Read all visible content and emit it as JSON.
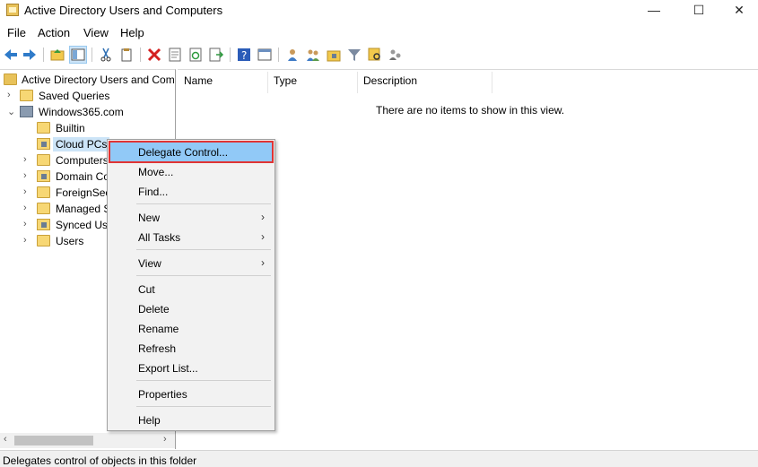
{
  "window": {
    "title": "Active Directory Users and Computers",
    "controls": {
      "minimize": "—",
      "maximize": "☐",
      "close": "✕"
    }
  },
  "menubar": [
    "File",
    "Action",
    "View",
    "Help"
  ],
  "toolbar": {
    "icons": [
      "back-icon",
      "forward-icon",
      "up-folder-icon",
      "show-tree-icon",
      "cut-icon",
      "copy-icon",
      "delete-icon",
      "properties-icon",
      "refresh-icon",
      "export-icon",
      "help-icon",
      "view-icon",
      "new-user-icon",
      "new-group-icon",
      "new-ou-icon",
      "filter-icon",
      "find-icon",
      "delegate-icon"
    ]
  },
  "tree": {
    "root": "Active Directory Users and Com",
    "saved_queries": "Saved Queries",
    "domain": "Windows365.com",
    "children": [
      "Builtin",
      "Cloud PCs",
      "Computers",
      "Domain Co",
      "ForeignSec",
      "Managed S",
      "Synced Use",
      "Users"
    ]
  },
  "list": {
    "columns": [
      "Name",
      "Type",
      "Description"
    ],
    "empty_message": "There are no items to show in this view."
  },
  "context_menu": {
    "items": [
      {
        "label": "Delegate Control...",
        "active": true
      },
      {
        "label": "Move..."
      },
      {
        "label": "Find..."
      },
      {
        "label": "New",
        "submenu": true
      },
      {
        "label": "All Tasks",
        "submenu": true
      },
      {
        "label": "View",
        "submenu": true
      },
      {
        "label": "Cut"
      },
      {
        "label": "Delete"
      },
      {
        "label": "Rename"
      },
      {
        "label": "Refresh"
      },
      {
        "label": "Export List..."
      },
      {
        "label": "Properties"
      },
      {
        "label": "Help"
      }
    ],
    "submenu_arrow": "›"
  },
  "status": {
    "text": "Delegates control of objects in this folder"
  },
  "colors": {
    "selection": "#cce4f7",
    "active_item": "#91c9f7",
    "highlight_border": "#e03434"
  }
}
